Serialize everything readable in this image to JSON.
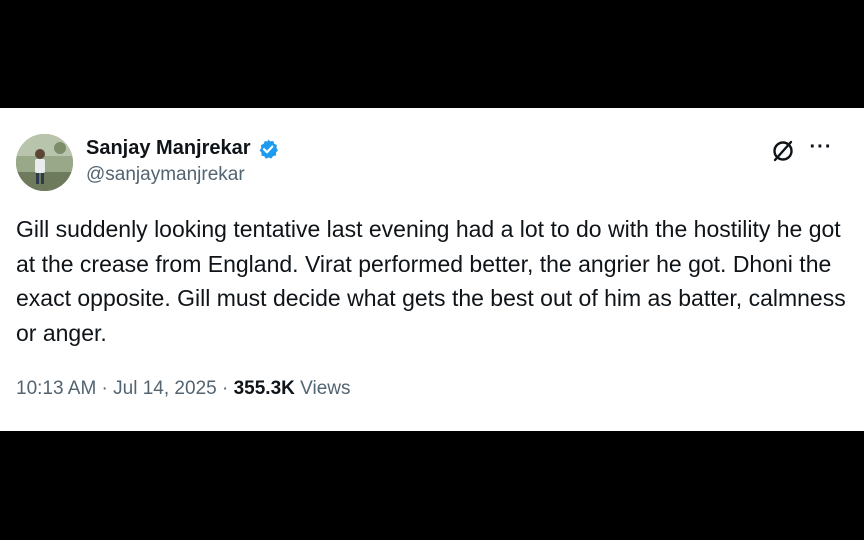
{
  "tweet": {
    "author_name": "Sanjay Manjrekar",
    "author_handle": "@sanjaymanjrekar",
    "verified": true,
    "text": "Gill suddenly looking tentative last evening had a lot to do with the hostility he got at the crease from England. Virat performed better, the angrier he got. Dhoni the exact opposite. Gill must decide what gets the best out of him as batter, calmness or anger.",
    "time": "10:13 AM",
    "separator": " · ",
    "date": "Jul 14, 2025",
    "views_count": "355.3K",
    "views_label": "Views"
  },
  "icons": {
    "verified": "verified-badge-icon",
    "grok": "grok-icon",
    "more": "more-options-icon"
  },
  "colors": {
    "background": "#000000",
    "card": "#ffffff",
    "text": "#0f1419",
    "secondary": "#536471",
    "verified": "#1d9bf0"
  }
}
